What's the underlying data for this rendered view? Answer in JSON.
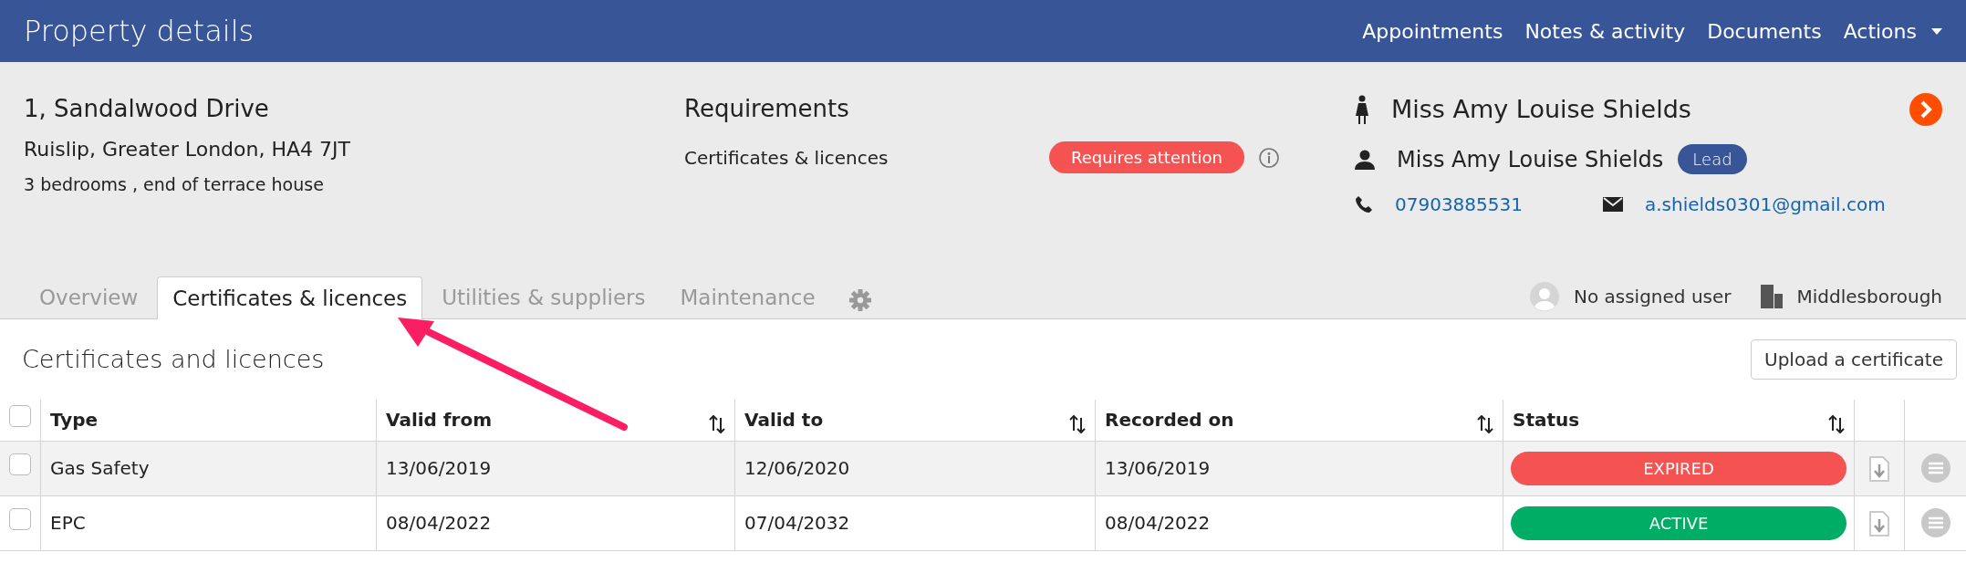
{
  "header": {
    "title": "Property details",
    "nav": [
      {
        "label": "Appointments",
        "kind": "link"
      },
      {
        "label": "Notes & activity",
        "kind": "link"
      },
      {
        "label": "Documents",
        "kind": "link"
      },
      {
        "label": "Actions",
        "kind": "dropdown"
      }
    ]
  },
  "property": {
    "address_line_1": "1, Sandalwood Drive",
    "address_line_2": "Ruislip, Greater London, HA4 7JT",
    "summary": "3 bedrooms , end of terrace house"
  },
  "requirements": {
    "title": "Requirements",
    "items": [
      {
        "label": "Certificates & licences",
        "status": "Requires attention",
        "kind": "danger"
      }
    ]
  },
  "contacts": {
    "tenant": "Miss Amy Louise Shields",
    "lead_name": "Miss Amy Louise Shields",
    "lead_badge": "Lead",
    "phone": "07903885531",
    "email": "a.shields0301@gmail.com"
  },
  "tabs": [
    {
      "label": "Overview",
      "selected": false
    },
    {
      "label": "Certificates & licences",
      "selected": true
    },
    {
      "label": "Utilities & suppliers",
      "selected": false
    },
    {
      "label": "Maintenance",
      "selected": false
    }
  ],
  "assigned_user": "No assigned user",
  "office": "Middlesborough",
  "section": {
    "title": "Certificates and licences",
    "upload_button": "Upload a certificate"
  },
  "table": {
    "select_all_checked": false,
    "columns": [
      {
        "label": "Type",
        "sortable": false
      },
      {
        "label": "Valid from",
        "sortable": true
      },
      {
        "label": "Valid to",
        "sortable": true
      },
      {
        "label": "Recorded on",
        "sortable": true
      },
      {
        "label": "Status",
        "sortable": true
      }
    ],
    "rows": [
      {
        "checked": false,
        "cells": [
          "Gas Safety",
          "13/06/2019",
          "12/06/2020",
          "13/06/2019"
        ],
        "status": "EXPIRED",
        "kind": "expired"
      },
      {
        "checked": false,
        "cells": [
          "EPC",
          "08/04/2022",
          "07/04/2032",
          "08/04/2022"
        ],
        "status": "ACTIVE",
        "kind": "active"
      }
    ]
  }
}
